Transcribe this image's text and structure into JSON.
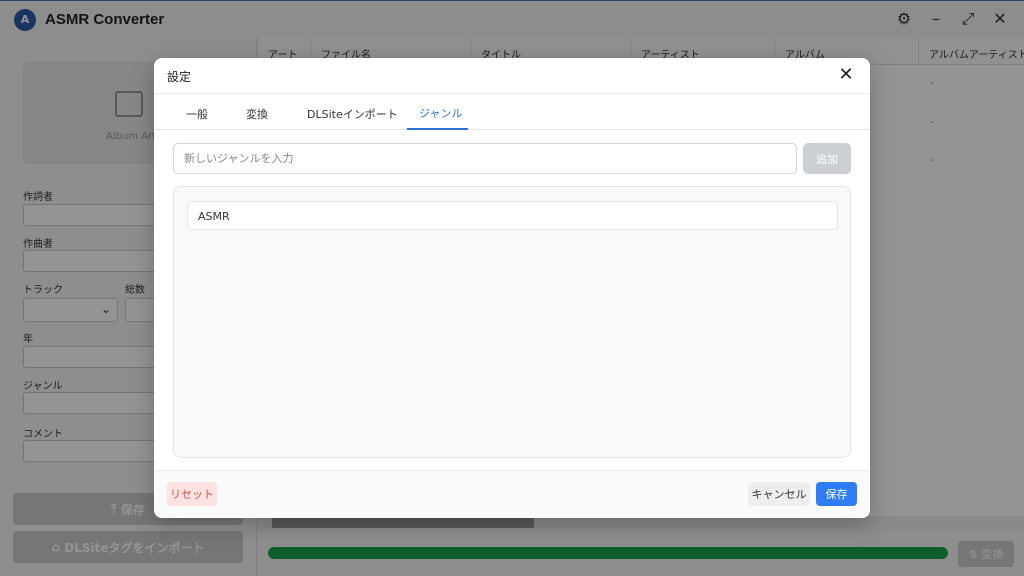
{
  "app": {
    "title": "ASMR Converter",
    "logo_text": "A"
  },
  "left_panel": {
    "album_art_label": "Album Art",
    "fields": {
      "lyricist": "作詞者",
      "composer": "作曲者",
      "track": "トラック",
      "total": "総数",
      "year": "年",
      "genre": "ジャンル",
      "comment": "コメント"
    },
    "save_button": "保存",
    "import_button": "DLSiteタグをインポート"
  },
  "table": {
    "columns": [
      "アート",
      "ファイル名",
      "タイトル",
      "アーティスト",
      "アルバム",
      "アルバムアーティスト"
    ],
    "placeholder_values": [
      "-",
      "-",
      "-"
    ]
  },
  "bottom": {
    "convert_button": "変換",
    "progress": 1.0
  },
  "dialog": {
    "title": "設定",
    "tabs": [
      "一般",
      "変換",
      "DLSiteインポート",
      "ジャンル"
    ],
    "active_tab": "ジャンル",
    "genre_input_placeholder": "新しいジャンルを入力",
    "add_button": "追加",
    "genres": [
      "ASMR"
    ],
    "reset_button": "リセット",
    "cancel_button": "キャンセル",
    "save_button": "保存"
  },
  "colors": {
    "accent": "#2e7cf6",
    "progress": "#17a34a",
    "reset": "#d9534f"
  }
}
